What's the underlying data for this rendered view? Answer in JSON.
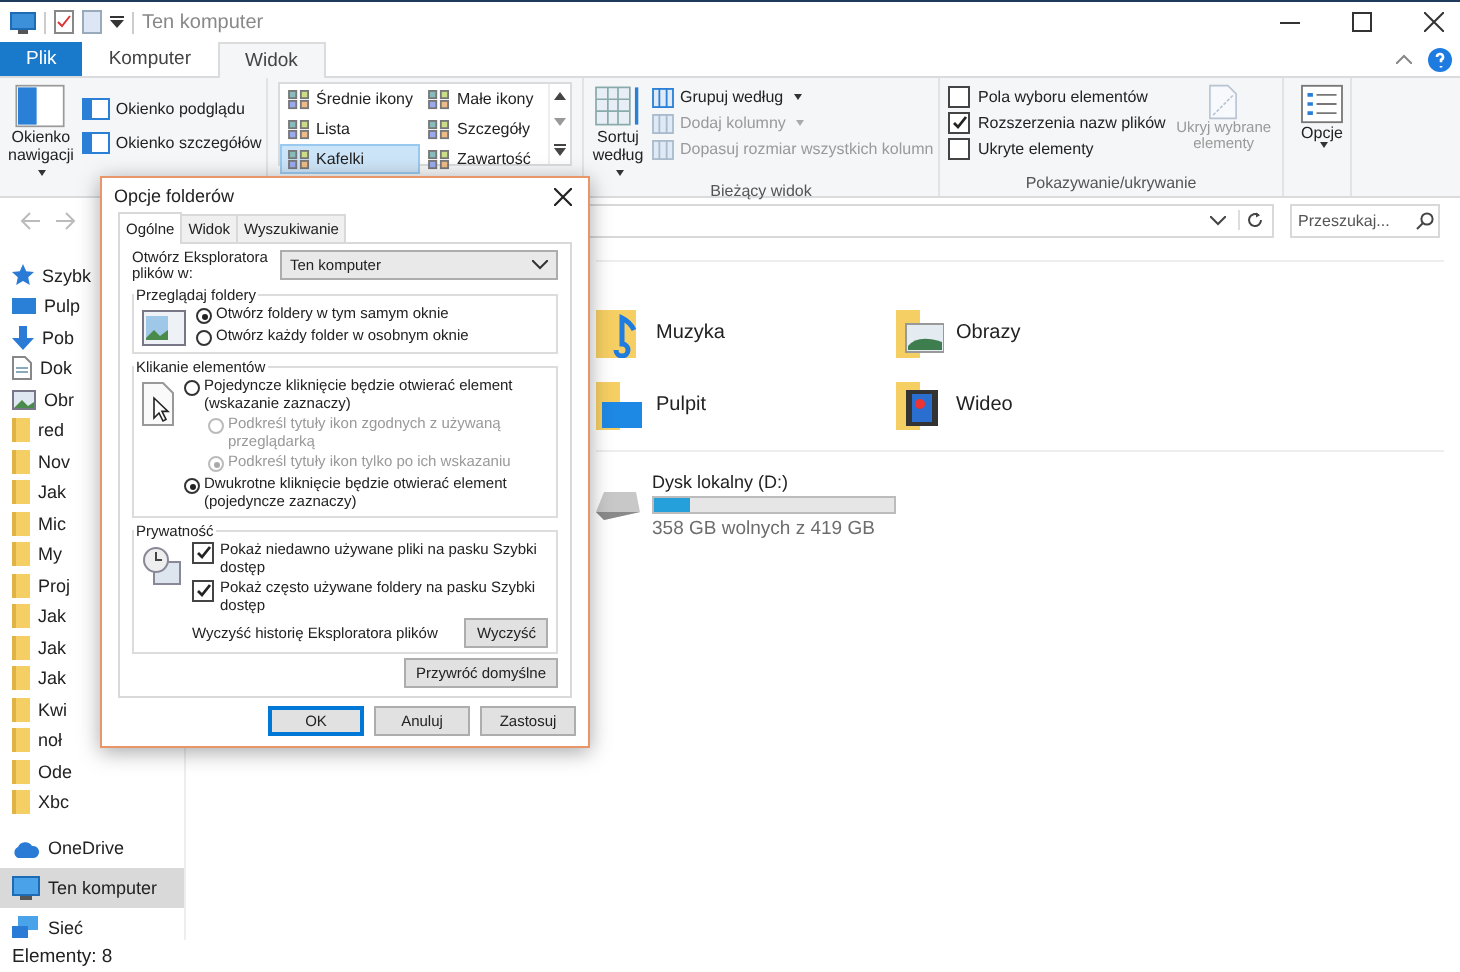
{
  "window": {
    "title": "Ten komputer"
  },
  "ribbon_tabs": [
    {
      "label": "Plik",
      "kind": "file",
      "selected": false
    },
    {
      "label": "Komputer",
      "kind": "tab",
      "selected": false
    },
    {
      "label": "Widok",
      "kind": "tab",
      "selected": true
    }
  ],
  "ribbon": {
    "panes": {
      "large": "Okienko nawigacji",
      "small": [
        "Okienko podglądu",
        "Okienko szczegółów"
      ]
    },
    "layouts": [
      {
        "label": "Średnie ikony",
        "selected": false
      },
      {
        "label": "Małe ikony",
        "selected": false
      },
      {
        "label": "Lista",
        "selected": false
      },
      {
        "label": "Szczegóły",
        "selected": false
      },
      {
        "label": "Kafelki",
        "selected": true
      },
      {
        "label": "Zawartość",
        "selected": false
      }
    ],
    "current_view": {
      "sort": "Sortuj według",
      "items": [
        {
          "label": "Grupuj według",
          "disabled": false
        },
        {
          "label": "Dodaj kolumny",
          "disabled": true
        },
        {
          "label": "Dopasuj rozmiar wszystkich kolumn",
          "disabled": true
        }
      ],
      "group_label": "Bieżący widok"
    },
    "show_hide": {
      "checkboxes": [
        {
          "label": "Pola wyboru elementów",
          "checked": false
        },
        {
          "label": "Rozszerzenia nazw plików",
          "checked": true
        },
        {
          "label": "Ukryte elementy",
          "checked": false
        }
      ],
      "hide_selected": {
        "label": "Ukryj wybrane elementy",
        "disabled": true
      },
      "group_label": "Pokazywanie/ukrywanie"
    },
    "options": {
      "label": "Opcje"
    }
  },
  "search": {
    "placeholder": "Przeszukaj..."
  },
  "sidebar": {
    "items": [
      {
        "label": "Szybk",
        "kind": "star",
        "selected": false
      },
      {
        "label": "Pulp",
        "kind": "desktop",
        "selected": false
      },
      {
        "label": "Pob",
        "kind": "download",
        "selected": false
      },
      {
        "label": "Dok",
        "kind": "document",
        "selected": false
      },
      {
        "label": "Obr",
        "kind": "pictures",
        "selected": false
      },
      {
        "label": "red",
        "kind": "folder",
        "selected": false
      },
      {
        "label": "Nov",
        "kind": "folder",
        "selected": false
      },
      {
        "label": "Jak",
        "kind": "folder",
        "selected": false
      },
      {
        "label": "Mic",
        "kind": "folder",
        "selected": false
      },
      {
        "label": "My",
        "kind": "folder",
        "selected": false
      },
      {
        "label": "Proj",
        "kind": "folder",
        "selected": false
      },
      {
        "label": "Jak",
        "kind": "folder",
        "selected": false
      },
      {
        "label": "Jak",
        "kind": "folder",
        "selected": false
      },
      {
        "label": "Jak",
        "kind": "folder",
        "selected": false
      },
      {
        "label": "Kwi",
        "kind": "folder",
        "selected": false
      },
      {
        "label": "noł",
        "kind": "folder",
        "selected": false
      },
      {
        "label": "Ode",
        "kind": "folder",
        "selected": false
      },
      {
        "label": "Xbc",
        "kind": "folder",
        "selected": false
      },
      {
        "label": "OneDrive",
        "kind": "cloud",
        "selected": false
      },
      {
        "label": "Ten komputer",
        "kind": "computer",
        "selected": true
      },
      {
        "label": "Sieć",
        "kind": "network",
        "selected": false
      }
    ]
  },
  "content": {
    "tiles": [
      {
        "name": "Muzyka",
        "kind": "music"
      },
      {
        "name": "Obrazy",
        "kind": "pictures"
      },
      {
        "name": "Pulpit",
        "kind": "desktop"
      },
      {
        "name": "Wideo",
        "kind": "video"
      }
    ],
    "drives": [
      {
        "name": "Dysk lokalny (D:)",
        "free": "358 GB wolnych z 419 GB",
        "level": 0.15
      }
    ]
  },
  "status_bar": {
    "count": "Elementy: 8"
  },
  "dialog": {
    "title": "Opcje folderów",
    "tabs": [
      {
        "label": "Ogólne",
        "selected": true
      },
      {
        "label": "Widok",
        "selected": false
      },
      {
        "label": "Wyszukiwanie",
        "selected": false
      }
    ],
    "open_in": {
      "label": "Otwórz Eksploratora plików w:",
      "value": "Ten komputer"
    },
    "browse": {
      "title": "Przeglądaj foldery",
      "options": [
        {
          "label": "Otwórz foldery w tym samym oknie",
          "selected": true
        },
        {
          "label": "Otwórz każdy folder w osobnym oknie",
          "selected": false
        }
      ]
    },
    "click": {
      "title": "Klikanie elementów",
      "options": [
        {
          "label": "Pojedyncze kliknięcie będzie otwierać element (wskazanie zaznaczy)",
          "selected": false,
          "children": [
            {
              "label": "Podkreśl tytuły ikon zgodnych z używaną przeglądarką",
              "selected": false,
              "disabled": true
            },
            {
              "label": "Podkreśl tytuły ikon tylko po ich wskazaniu",
              "selected": true,
              "disabled": true
            }
          ]
        },
        {
          "label": "Dwukrotne kliknięcie będzie otwierać element (pojedyncze zaznaczy)",
          "selected": true
        }
      ]
    },
    "privacy": {
      "title": "Prywatność",
      "checkboxes": [
        {
          "label": "Pokaż niedawno używane pliki na pasku Szybki dostęp",
          "checked": true
        },
        {
          "label": "Pokaż często używane foldery na pasku Szybki dostęp",
          "checked": true
        }
      ],
      "clear_label": "Wyczyść historię Eksploratora plików",
      "clear_button": "Wyczyść"
    },
    "restore_button": "Przywróć domyślne",
    "buttons": [
      {
        "label": "OK",
        "kind": "default"
      },
      {
        "label": "Anuluj",
        "kind": "normal"
      },
      {
        "label": "Zastosuj",
        "kind": "normal"
      }
    ]
  }
}
